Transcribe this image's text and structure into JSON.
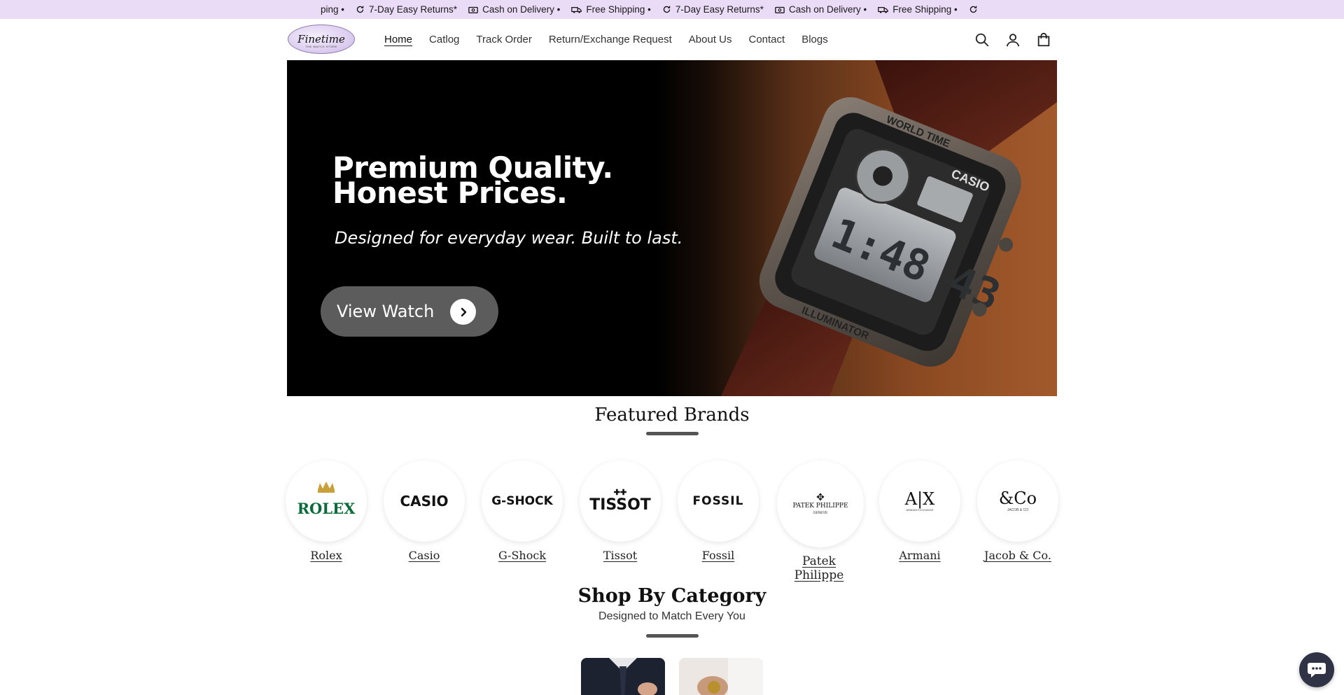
{
  "announcement": {
    "items": [
      {
        "icon": "return-icon",
        "text": "ping •"
      },
      {
        "icon": "return-icon",
        "text": "7-Day Easy Returns*"
      },
      {
        "icon": "cash-icon",
        "text": "Cash on Delivery •"
      },
      {
        "icon": "truck-icon",
        "text": "Free Shipping •"
      },
      {
        "icon": "return-icon",
        "text": "7-Day Easy Returns*"
      },
      {
        "icon": "cash-icon",
        "text": "Cash on Delivery •"
      },
      {
        "icon": "truck-icon",
        "text": "Free Shipping •"
      }
    ],
    "background": "#eadcf6"
  },
  "header": {
    "logo_text": "Finetime",
    "logo_subtext": "THE WATCH STORE",
    "nav": [
      {
        "label": "Home",
        "active": true
      },
      {
        "label": "Catlog"
      },
      {
        "label": "Track Order"
      },
      {
        "label": "Return/Exchange Request"
      },
      {
        "label": "About Us"
      },
      {
        "label": "Contact"
      },
      {
        "label": "Blogs"
      }
    ],
    "icons": [
      "search-icon",
      "account-icon",
      "cart-icon"
    ]
  },
  "hero": {
    "title_line1": "Premium Quality.",
    "title_line2": "Honest Prices.",
    "subtitle": "Designed for everyday wear. Built to last.",
    "button_label": "View Watch",
    "watch_brand": "CASIO",
    "watch_time": "1:48 43",
    "watch_bezel_top": "WORLD TIME",
    "watch_bezel_bottom": "ILLUMINATOR"
  },
  "featured_brands": {
    "title": "Featured Brands",
    "brands": [
      {
        "name": "Rolex",
        "logo_text": "ROLEX",
        "color": "#0a6b3a"
      },
      {
        "name": "Casio",
        "logo_text": "CASIO",
        "color": "#111111"
      },
      {
        "name": "G-Shock",
        "logo_text": "G-SHOCK",
        "color": "#111111"
      },
      {
        "name": "Tissot",
        "logo_text": "TISSOT",
        "color": "#111111"
      },
      {
        "name": "Fossil",
        "logo_text": "FOSSIL",
        "color": "#111111"
      },
      {
        "name": "Patek Philippe",
        "logo_text": "PATEK PHILIPPE",
        "logo_sub": "GENEVE",
        "color": "#111111"
      },
      {
        "name": "Armani",
        "logo_text": "A|X",
        "logo_sub": "ARMANI EXCHANGE",
        "color": "#111111"
      },
      {
        "name": "Jacob & Co.",
        "logo_text": "&Co",
        "logo_sub": "JACOB & CO",
        "color": "#111111"
      }
    ]
  },
  "category": {
    "title": "Shop By Category",
    "subtitle": "Designed to Match Every You"
  },
  "chat": {
    "icon": "chat-icon"
  }
}
